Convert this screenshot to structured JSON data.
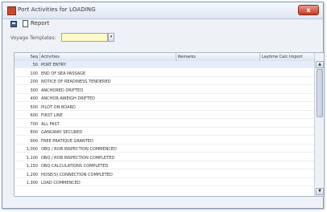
{
  "window": {
    "title": "Port Activities for LOADING",
    "close_label": "x"
  },
  "toolbar": {
    "report_label": "Report"
  },
  "form": {
    "template_label": "Voyage Templates:",
    "template_value": ""
  },
  "grid": {
    "columns": [
      "Seq",
      "Activities",
      "Remarks",
      "Laytime Calc Import"
    ],
    "rows": [
      {
        "seq": "50",
        "activity": "PORT ENTRY"
      },
      {
        "seq": "100",
        "activity": "END OF SEA PASSAGE"
      },
      {
        "seq": "200",
        "activity": "NOTICE OF READINESS TENDERED"
      },
      {
        "seq": "300",
        "activity": "ANCHORED DRIFTED"
      },
      {
        "seq": "400",
        "activity": "ANCHOR AWEIGH DRIFTED"
      },
      {
        "seq": "500",
        "activity": "PILOT ON BOARD"
      },
      {
        "seq": "600",
        "activity": "FIRST LINE"
      },
      {
        "seq": "700",
        "activity": "ALL FAST"
      },
      {
        "seq": "800",
        "activity": "GANGWAY SECURED"
      },
      {
        "seq": "900",
        "activity": "FREE PRATIQUE GRANTED"
      },
      {
        "seq": "1,000",
        "activity": "OBQ / ROB INSPECTION COMMENCED"
      },
      {
        "seq": "1,100",
        "activity": "OBQ / ROB INSPECTION COMPLETED"
      },
      {
        "seq": "1,150",
        "activity": "OBQ CALCULATIONS COMPLETED"
      },
      {
        "seq": "1,200",
        "activity": "HOSE(S) CONNECTION COMPLETED"
      },
      {
        "seq": "1,300",
        "activity": "LOAD COMMENCED"
      }
    ]
  },
  "icons": {
    "save": "save-icon",
    "report": "report-icon",
    "close": "close-icon",
    "dropdown": "chevron-down-icon",
    "scroll_up": "arrow-up-icon",
    "scroll_down": "arrow-down-icon"
  },
  "colors": {
    "template_input_bg": "#fff9c8",
    "close_button": "#c33b24",
    "selected_row": "#e4edf9"
  }
}
